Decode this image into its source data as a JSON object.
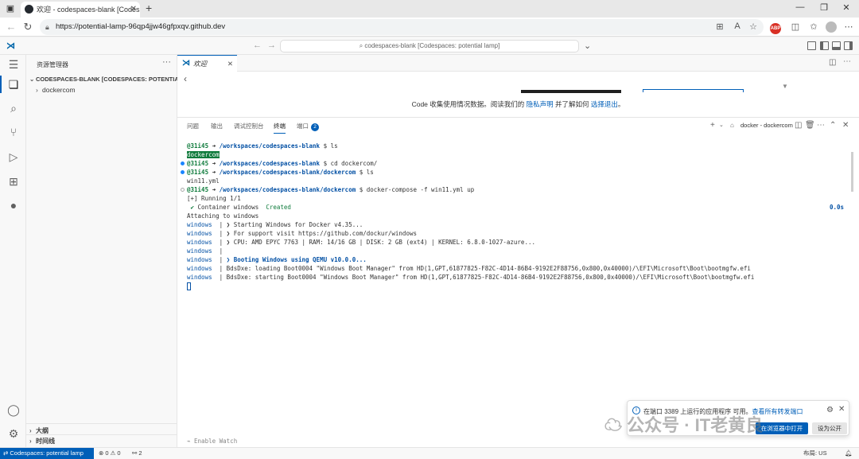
{
  "browser": {
    "tab_title": "欢迎 - codespaces-blank [Codesp",
    "url": "https://potential-lamp-96qp4jjw46gfpxqv.github.dev",
    "ext_badge": "ABP"
  },
  "titlebar": {
    "command_center": "codespaces-blank [Codespaces: potential lamp]"
  },
  "sidebar": {
    "title": "资源管理器",
    "more": "···",
    "root_folder": "CODESPACES-BLANK [CODESPACES: POTENTIAL LA...",
    "items": [
      {
        "label": "dockercom"
      }
    ],
    "outline": "大纲",
    "timeline": "时间线"
  },
  "editor": {
    "tab_label": "欢迎",
    "consent": {
      "prefix": "Code 收集使用情况数据。阅读我们的 ",
      "privacy_link": "隐私声明",
      "middle": " 并了解如何 ",
      "optout_link": "选择退出",
      "suffix": "。"
    }
  },
  "panel": {
    "tabs": [
      "问题",
      "输出",
      "调试控制台",
      "终端",
      "端口"
    ],
    "ports_count": "2",
    "terminal_name": "docker - dockercom",
    "enable_watch": "Enable Watch"
  },
  "terminal": {
    "prompt_user": "@31i45",
    "prompt_arrow": "➜",
    "line1": {
      "path": "/workspaces/codespaces-blank",
      "cmd": " $ ls"
    },
    "line2": "dockercom",
    "line3": {
      "path": "/workspaces/codespaces-blank",
      "cmd": " $ cd dockercom/"
    },
    "line4": {
      "path": "/workspaces/codespaces-blank/dockercom",
      "cmd": " $ ls"
    },
    "line5": "win11.yml",
    "line6": {
      "path": "/workspaces/codespaces-blank/dockercom",
      "cmd": " $ docker-compose -f win11.yml up"
    },
    "line7": "[+] Running 1/1",
    "line8": {
      "check": "✔",
      "text": " Container windows  ",
      "status": "Created",
      "time": "0.0s"
    },
    "line9": "Attaching to windows",
    "svc": "windows",
    "pipe": "  | ",
    "logs": [
      {
        "text": "❯ Starting Windows for Docker v4.35...",
        "bold": false
      },
      {
        "text": "❯ For support visit https://github.com/dockur/windows",
        "bold": false
      },
      {
        "text": "❯ CPU: AMD EPYC 7763 | RAM: 14/16 GB | DISK: 2 GB (ext4) | KERNEL: 6.8.0-1027-azure...",
        "bold": false
      },
      {
        "text": "",
        "bold": false
      },
      {
        "text": "❯ Booting Windows using QEMU v10.0.0...",
        "bold": true
      },
      {
        "text": "BdsDxe: loading Boot0004 \"Windows Boot Manager\" from HD(1,GPT,61877825-F82C-4D14-86B4-9192E2F88756,0x800,0x40000)/\\EFI\\Microsoft\\Boot\\bootmgfw.efi",
        "bold": false
      },
      {
        "text": "BdsDxe: starting Boot0004 \"Windows Boot Manager\" from HD(1,GPT,61877825-F82C-4D14-86B4-9192E2F88756,0x800,0x40000)/\\EFI\\Microsoft\\Boot\\bootmgfw.efi",
        "bold": false
      }
    ]
  },
  "notification": {
    "text": "在端口 3389 上运行的应用程序 可用。",
    "link": "查看所有转发端口",
    "primary": "在浏览器中打开",
    "secondary": "设为公开"
  },
  "watermark": "公众号 · IT老黄良",
  "statusbar": {
    "remote": "Codespaces: potential lamp",
    "problems": "⊗ 0 ⚠ 0",
    "ports": "⚯ 2",
    "layout": "布局: US"
  },
  "colors": {
    "accent": "#005fb8",
    "prompt_green": "#0f7b3c",
    "path_blue": "#0451a5"
  }
}
